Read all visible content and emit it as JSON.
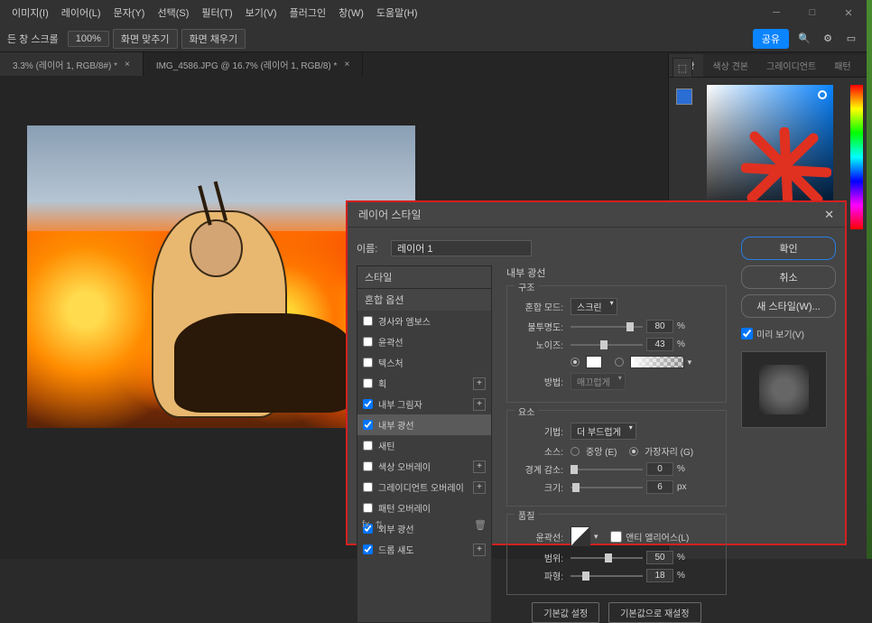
{
  "menu": {
    "items": [
      "이미지(I)",
      "레이어(L)",
      "문자(Y)",
      "선택(S)",
      "필터(T)",
      "보기(V)",
      "플러그인",
      "창(W)",
      "도움말(H)"
    ]
  },
  "toolbar": {
    "scroll_label": "든 창 스크롤",
    "zoom": "100%",
    "fit_screen": "화면 맞추기",
    "fill_screen": "화면 채우기",
    "share": "공유"
  },
  "tabs": [
    {
      "label": "3.3% (레이어 1, RGB/8#) *"
    },
    {
      "label": "IMG_4586.JPG @ 16.7% (레이어 1, RGB/8) *"
    }
  ],
  "panels": {
    "color_tabs": [
      "색상",
      "색상 견본",
      "그레이디언트",
      "패턴"
    ]
  },
  "dialog": {
    "title": "레이어 스타일",
    "name_label": "이름:",
    "name_value": "레이어 1",
    "ok": "확인",
    "cancel": "취소",
    "new_style": "새 스타일(W)...",
    "preview": "미리 보기(V)",
    "list_header_styles": "스타일",
    "list_header_blend": "혼합 옵션",
    "effects": {
      "bevel": "경사와 엠보스",
      "contour": "윤곽선",
      "texture": "텍스처",
      "stroke": "획",
      "inner_shadow": "내부 그림자",
      "inner_glow": "내부 광선",
      "satin": "새틴",
      "color_overlay": "색상 오버레이",
      "gradient_overlay": "그레이디언트 오버레이",
      "pattern_overlay": "패턴 오버레이",
      "outer_glow": "외부 광선",
      "drop_shadow": "드롭 섀도"
    },
    "sect_structure": "구조",
    "sect_elements": "요소",
    "sect_quality": "품질",
    "section_title": "내부 광선",
    "blend_mode_label": "혼합 모드:",
    "blend_mode_value": "스크린",
    "opacity_label": "불투명도:",
    "opacity_value": "80",
    "noise_label": "노이즈:",
    "noise_value": "43",
    "method_label": "방법:",
    "method_value": "매끄럽게",
    "technique_label": "기법:",
    "technique_value": "더 부드럽게",
    "source_label": "소스:",
    "source_center": "중앙 (E)",
    "source_edge": "가장자리 (G)",
    "choke_label": "경계 감소:",
    "choke_value": "0",
    "size_label": "크기:",
    "size_value": "6",
    "contour_label": "윤곽선:",
    "antialias": "앤티 앨리어스(L)",
    "range_label": "범위:",
    "range_value": "50",
    "jitter_label": "파형:",
    "jitter_value": "18",
    "percent": "%",
    "px": "px",
    "reset_default": "기본값 설정",
    "make_default": "기본값으로 재설정"
  }
}
